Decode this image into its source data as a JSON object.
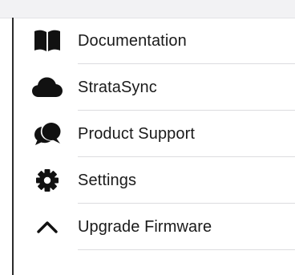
{
  "menu": {
    "items": [
      {
        "label": "Documentation",
        "icon": "book-icon"
      },
      {
        "label": "StrataSync",
        "icon": "cloud-icon"
      },
      {
        "label": "Product Support",
        "icon": "chat-bubbles-icon"
      },
      {
        "label": "Settings",
        "icon": "gear-icon"
      },
      {
        "label": "Upgrade Firmware",
        "icon": "chevron-up-icon"
      }
    ]
  },
  "colors": {
    "icon": "#111111",
    "text": "#1a1a1a",
    "separator": "#dcdcdf",
    "top_strip": "#f2f2f4"
  }
}
